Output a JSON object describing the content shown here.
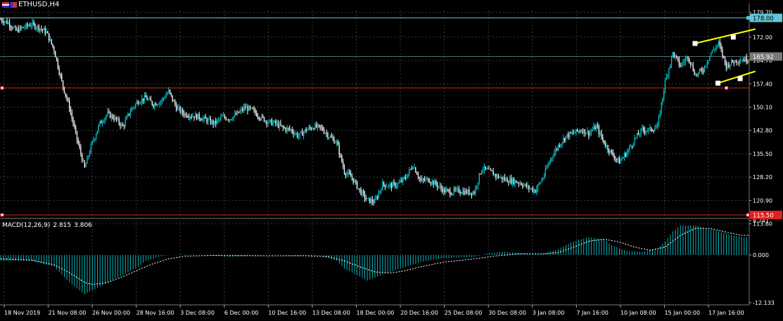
{
  "symbol": "ETHUSD,H4",
  "macd": {
    "label": "MACD(12,26,9)",
    "main": "2.815",
    "signal": "3.806"
  },
  "colors": {
    "background": "#000000",
    "bull": "#00c8d2",
    "bear": "#ffffff",
    "grid": "#3a3a3a",
    "resistance": "#5fc6d8",
    "support": "#e02020",
    "bid": "#6a8fa0",
    "channel": "#ffff00",
    "text": "#ffffff"
  },
  "chart_data": [
    {
      "type": "candlestick",
      "title": "ETHUSD,H4",
      "ylim": [
        115.5,
        180.3
      ],
      "price_ticks": [
        "179.70",
        "172.00",
        "164.70",
        "157.40",
        "150.10",
        "142.80",
        "135.50",
        "128.20",
        "120.90",
        "113.60"
      ],
      "time_ticks": [
        "18 Nov 2019",
        "21 Nov 08:00",
        "26 Nov 00:00",
        "28 Nov 16:00",
        "3 Dec 08:00",
        "6 Dec 00:00",
        "10 Dec 16:00",
        "13 Dec 08:00",
        "18 Dec 00:00",
        "20 Dec 16:00",
        "25 Dec 08:00",
        "30 Dec 08:00",
        "3 Jan 08:00",
        "7 Jan 16:00",
        "10 Jan 08:00",
        "15 Jan 00:00",
        "17 Jan 16:00"
      ],
      "anchors": [
        [
          0,
          177.5
        ],
        [
          1,
          176.5
        ],
        [
          2,
          174
        ],
        [
          3,
          175
        ],
        [
          4,
          176
        ],
        [
          5,
          175
        ],
        [
          6,
          173.5
        ],
        [
          7,
          168
        ],
        [
          8,
          158
        ],
        [
          9,
          150
        ],
        [
          10,
          140
        ],
        [
          11,
          131
        ],
        [
          12,
          139
        ],
        [
          13,
          145
        ],
        [
          14,
          148
        ],
        [
          15,
          146.5
        ],
        [
          16,
          144
        ],
        [
          17,
          149
        ],
        [
          18,
          152
        ],
        [
          19,
          153
        ],
        [
          20,
          151
        ],
        [
          21,
          152
        ],
        [
          22,
          155
        ],
        [
          23,
          150
        ],
        [
          24,
          148
        ],
        [
          25,
          147.5
        ],
        [
          26,
          147
        ],
        [
          27,
          146
        ],
        [
          28,
          145
        ],
        [
          29,
          147
        ],
        [
          30,
          146.5
        ],
        [
          31,
          148
        ],
        [
          32,
          150
        ],
        [
          33,
          149
        ],
        [
          34,
          147
        ],
        [
          35,
          145.5
        ],
        [
          36,
          145
        ],
        [
          37,
          143.5
        ],
        [
          38,
          143
        ],
        [
          39,
          141
        ],
        [
          40,
          143
        ],
        [
          41,
          144
        ],
        [
          42,
          143.5
        ],
        [
          43,
          141
        ],
        [
          44,
          139
        ],
        [
          45,
          130
        ],
        [
          46,
          128
        ],
        [
          47,
          124
        ],
        [
          48,
          121
        ],
        [
          49,
          120.5
        ],
        [
          50,
          126
        ],
        [
          51,
          125.5
        ],
        [
          52,
          126
        ],
        [
          53,
          128
        ],
        [
          54,
          132
        ],
        [
          55,
          127
        ],
        [
          56,
          127.5
        ],
        [
          57,
          126
        ],
        [
          58,
          124
        ],
        [
          59,
          123.5
        ],
        [
          60,
          124
        ],
        [
          61,
          123.5
        ],
        [
          62,
          123.5
        ],
        [
          63,
          131
        ],
        [
          64,
          130
        ],
        [
          65,
          128.5
        ],
        [
          66,
          127.5
        ],
        [
          67,
          127
        ],
        [
          68,
          126.5
        ],
        [
          69,
          125
        ],
        [
          70,
          124
        ],
        [
          71,
          128
        ],
        [
          72,
          134
        ],
        [
          73,
          138
        ],
        [
          74,
          141
        ],
        [
          75,
          142
        ],
        [
          76,
          143
        ],
        [
          77,
          142
        ],
        [
          78,
          144
        ],
        [
          79,
          139
        ],
        [
          80,
          135.5
        ],
        [
          81,
          133
        ],
        [
          82,
          136
        ],
        [
          83,
          140
        ],
        [
          84,
          143
        ],
        [
          85,
          143
        ],
        [
          86,
          144
        ],
        [
          87,
          158
        ],
        [
          88,
          167
        ],
        [
          89,
          163
        ],
        [
          90,
          166
        ],
        [
          91,
          160
        ],
        [
          92,
          162
        ],
        [
          93,
          167
        ],
        [
          94,
          170
        ],
        [
          95,
          163
        ],
        [
          96,
          164.5
        ],
        [
          97,
          165
        ]
      ],
      "resistance_level": 178.0,
      "resistance_label": "178.00",
      "current_price": 165.92,
      "current_price_label": "165.92",
      "support_level": 115.5,
      "support_label": "115.50",
      "middle_level": 156.1,
      "channel": {
        "upper": {
          "from": [
            90.5,
            170.0
          ],
          "to": [
            98.4,
            174.5
          ],
          "mid_point": [
            95.5,
            172.0
          ]
        },
        "lower": {
          "from": [
            93.5,
            157.6
          ],
          "to": [
            98.4,
            161.3
          ],
          "mid_point": [
            96.4,
            159.0
          ]
        }
      }
    },
    {
      "type": "histogram",
      "title": "MACD(12,26,9) 2.815 3.806",
      "ylim": [
        -12.133,
        8.741
      ],
      "ticks": [
        "8.741",
        "0.000",
        "-12.133"
      ],
      "histogram_anchors": [
        [
          0,
          -1.5
        ],
        [
          4,
          -1.5
        ],
        [
          7,
          -3
        ],
        [
          9,
          -7
        ],
        [
          10,
          -8.5
        ],
        [
          11,
          -10
        ],
        [
          12,
          -9
        ],
        [
          14,
          -7
        ],
        [
          16,
          -5
        ],
        [
          18,
          -3
        ],
        [
          19,
          -1.5
        ],
        [
          21,
          -0.3
        ],
        [
          23,
          0.1
        ],
        [
          26,
          0
        ],
        [
          30,
          -0.5
        ],
        [
          33,
          -0.2
        ],
        [
          36,
          0.1
        ],
        [
          39,
          -0.3
        ],
        [
          42,
          -0.2
        ],
        [
          44,
          -1.5
        ],
        [
          45,
          -3.5
        ],
        [
          47,
          -5.5
        ],
        [
          48,
          -6.5
        ],
        [
          50,
          -5
        ],
        [
          53,
          -3
        ],
        [
          55,
          -1.8
        ],
        [
          58,
          -0.8
        ],
        [
          62,
          -0.5
        ],
        [
          64,
          0.5
        ],
        [
          66,
          0.8
        ],
        [
          68,
          0.5
        ],
        [
          70,
          0.2
        ],
        [
          71,
          0.3
        ],
        [
          73,
          1.5
        ],
        [
          75,
          3.5
        ],
        [
          77,
          4.5
        ],
        [
          79,
          4
        ],
        [
          80,
          2.5
        ],
        [
          82,
          1
        ],
        [
          84,
          0.8
        ],
        [
          86,
          1.5
        ],
        [
          87,
          3.5
        ],
        [
          88,
          6
        ],
        [
          89,
          7.5
        ],
        [
          91,
          7.5
        ],
        [
          93,
          6.5
        ],
        [
          95,
          5.5
        ],
        [
          97,
          4.5
        ]
      ],
      "signal_anchors": [
        [
          0,
          -1
        ],
        [
          4,
          -1.3
        ],
        [
          7,
          -2.5
        ],
        [
          9,
          -4.5
        ],
        [
          11,
          -7
        ],
        [
          12,
          -7.5
        ],
        [
          14,
          -7
        ],
        [
          16,
          -5.5
        ],
        [
          18,
          -3.8
        ],
        [
          20,
          -2.2
        ],
        [
          22,
          -1
        ],
        [
          24,
          -0.3
        ],
        [
          28,
          -0.1
        ],
        [
          34,
          -0.2
        ],
        [
          40,
          -0.2
        ],
        [
          43,
          -0.5
        ],
        [
          45,
          -1.5
        ],
        [
          47,
          -3
        ],
        [
          49,
          -4.3
        ],
        [
          51,
          -4.6
        ],
        [
          53,
          -4
        ],
        [
          55,
          -3
        ],
        [
          58,
          -1.8
        ],
        [
          62,
          -1
        ],
        [
          65,
          -0.2
        ],
        [
          68,
          0.3
        ],
        [
          71,
          0.3
        ],
        [
          73,
          0.6
        ],
        [
          75,
          2
        ],
        [
          77,
          3.5
        ],
        [
          79,
          4
        ],
        [
          81,
          3.3
        ],
        [
          83,
          2
        ],
        [
          85,
          1.2
        ],
        [
          87,
          2
        ],
        [
          88,
          3.5
        ],
        [
          89,
          5
        ],
        [
          91,
          6.8
        ],
        [
          93,
          6.7
        ],
        [
          95,
          5.8
        ],
        [
          97,
          5
        ]
      ]
    }
  ]
}
